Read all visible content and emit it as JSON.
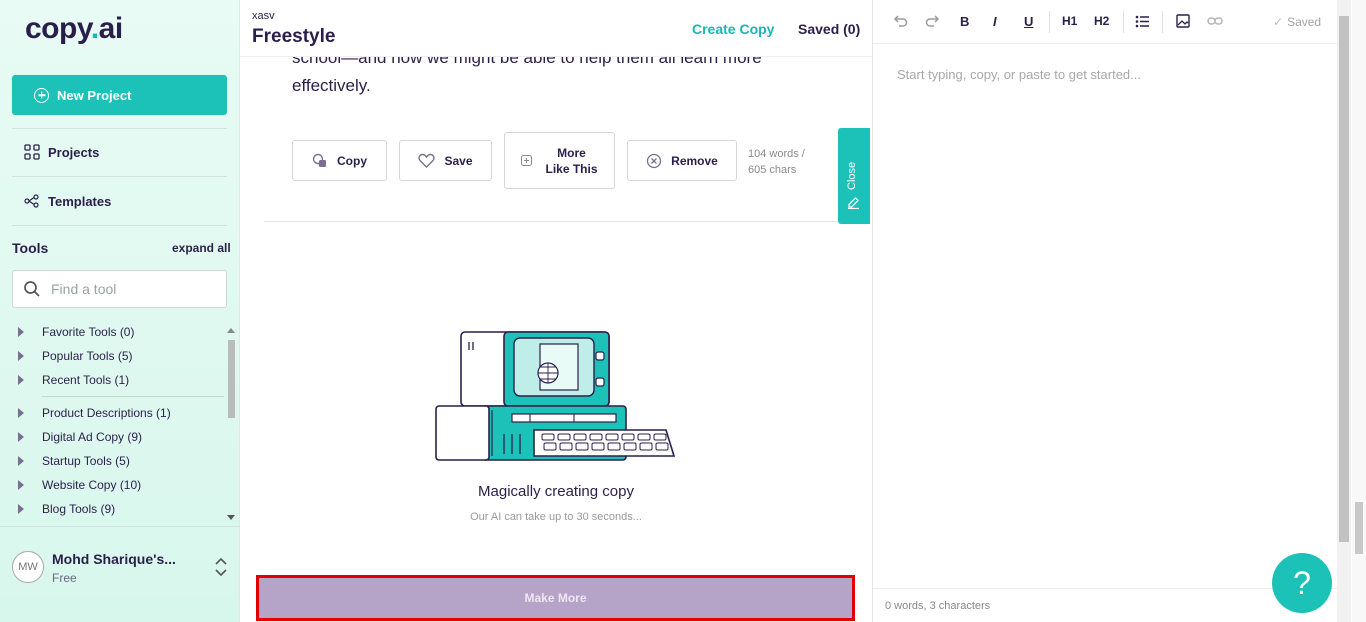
{
  "sidebar": {
    "logo_main": "copy",
    "logo_dot": ".",
    "logo_end": "ai",
    "new_project": "New Project",
    "nav": {
      "projects": "Projects",
      "templates": "Templates"
    },
    "tools_title": "Tools",
    "expand_all": "expand all",
    "search_placeholder": "Find a tool",
    "tool_groups": [
      "Favorite Tools (0)",
      "Popular Tools (5)",
      "Recent Tools (1)",
      "Product Descriptions (1)",
      "Digital Ad Copy (9)",
      "Startup Tools (5)",
      "Website Copy (10)",
      "Blog Tools (9)"
    ],
    "user": {
      "initials": "MW",
      "name": "Mohd Sharique's...",
      "plan": "Free"
    }
  },
  "main": {
    "project_sub": "xasv",
    "project_title": "Freestyle",
    "tabs": {
      "create": "Create Copy",
      "saved": "Saved (0)"
    },
    "result_text": "school—and how we might be able to help them all learn more effectively.",
    "actions": {
      "copy": "Copy",
      "save": "Save",
      "more_like_this_1": "More",
      "more_like_this_2": "Like This",
      "remove": "Remove"
    },
    "word_count_1": "104 words /",
    "word_count_2": "605 chars",
    "close_label": "Close",
    "magic_title": "Magically creating copy",
    "magic_sub": "Our AI can take up to 30 seconds...",
    "make_more": "Make More"
  },
  "editor": {
    "toolbar": {
      "h1": "H1",
      "h2": "H2",
      "bold": "B",
      "italic": "I",
      "underline": "U"
    },
    "saved": "Saved",
    "placeholder": "Start typing, copy, or paste to get started...",
    "footer": "0 words, 3 characters",
    "help": "?"
  },
  "colors": {
    "accent": "#1cc2b8",
    "dark": "#2a1f4a",
    "make_more_bg": "#b5a3c8",
    "highlight_border": "#e00000"
  }
}
